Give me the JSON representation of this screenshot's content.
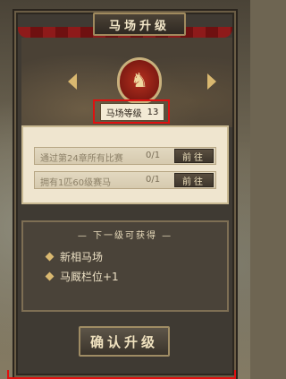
{
  "title": "马场升级",
  "level": {
    "label": "马场等级",
    "value": "13"
  },
  "requirements": [
    {
      "text": "通过第24章所有比赛",
      "count": "0/1",
      "button": "前往"
    },
    {
      "text": "拥有1匹60级赛马",
      "count": "0/1",
      "button": "前往"
    }
  ],
  "rewards": {
    "title": "— 下一级可获得 —",
    "items": [
      "新相马场",
      "马厩栏位+1"
    ]
  },
  "confirm_label": "确认升级",
  "colors": {
    "accent": "#d9b870",
    "highlight": "#e01010"
  },
  "icons": [
    "horse-emblem-icon",
    "left-arrow-icon",
    "right-arrow-icon",
    "gem-bullet-icon"
  ]
}
